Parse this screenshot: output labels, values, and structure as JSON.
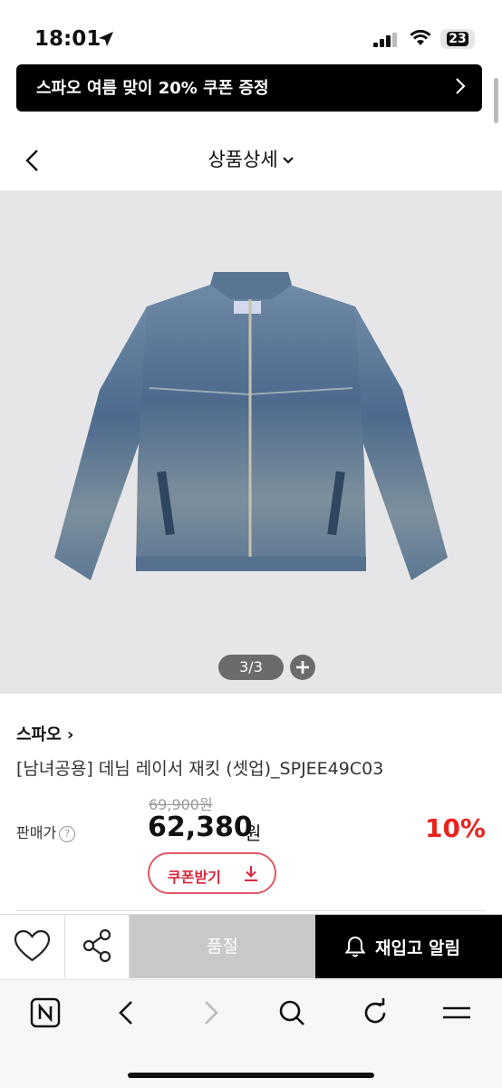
{
  "status": {
    "time": "18:01",
    "battery": "23"
  },
  "banner": {
    "text": "스파오 여름 맞이 20% 쿠폰 증정"
  },
  "header": {
    "title": "상품상세"
  },
  "gallery": {
    "pager": "3/3"
  },
  "product": {
    "brand": "스파오 ›",
    "name": "[남녀공용] 데님 레이서 재킷 (셋업)_SPJEE49C03",
    "original_price": "69,900원",
    "price_label": "판매가",
    "help": "?",
    "price": "62,380",
    "currency": "원",
    "discount": "10%",
    "coupon_label": "쿠폰받기"
  },
  "actions": {
    "soldout": "품절",
    "restock": "재입고 알림"
  },
  "colors": {
    "accent": "#e8231f",
    "coupon": "#d9263b",
    "soldout_bg": "#c9c9c9",
    "banner_bg": "#000000"
  },
  "icons": [
    "location-arrow-icon",
    "signal-icon",
    "wifi-icon",
    "battery-icon",
    "chevron-right-icon",
    "back-icon",
    "chevron-down-icon",
    "plus-icon",
    "question-icon",
    "download-icon",
    "heart-icon",
    "share-icon",
    "bell-icon",
    "naver-icon",
    "back-arrow-icon",
    "forward-arrow-icon",
    "search-icon",
    "refresh-icon",
    "menu-icon"
  ]
}
